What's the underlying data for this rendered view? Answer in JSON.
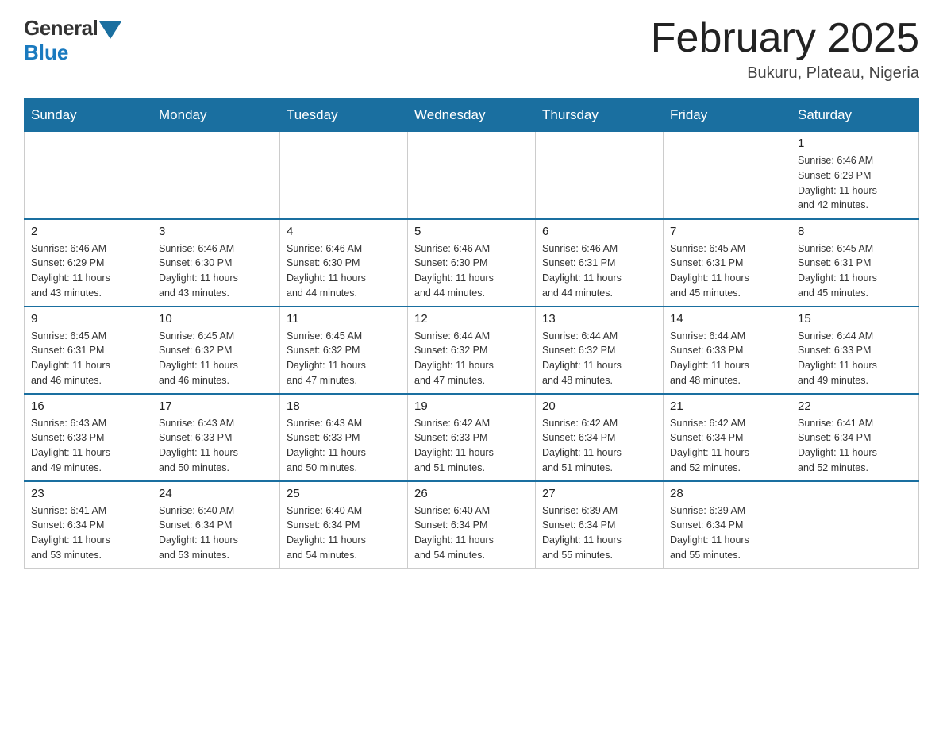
{
  "header": {
    "title": "February 2025",
    "location": "Bukuru, Plateau, Nigeria",
    "logo_general": "General",
    "logo_blue": "Blue"
  },
  "days_of_week": [
    "Sunday",
    "Monday",
    "Tuesday",
    "Wednesday",
    "Thursday",
    "Friday",
    "Saturday"
  ],
  "weeks": [
    [
      {
        "day": "",
        "info": ""
      },
      {
        "day": "",
        "info": ""
      },
      {
        "day": "",
        "info": ""
      },
      {
        "day": "",
        "info": ""
      },
      {
        "day": "",
        "info": ""
      },
      {
        "day": "",
        "info": ""
      },
      {
        "day": "1",
        "info": "Sunrise: 6:46 AM\nSunset: 6:29 PM\nDaylight: 11 hours\nand 42 minutes."
      }
    ],
    [
      {
        "day": "2",
        "info": "Sunrise: 6:46 AM\nSunset: 6:29 PM\nDaylight: 11 hours\nand 43 minutes."
      },
      {
        "day": "3",
        "info": "Sunrise: 6:46 AM\nSunset: 6:30 PM\nDaylight: 11 hours\nand 43 minutes."
      },
      {
        "day": "4",
        "info": "Sunrise: 6:46 AM\nSunset: 6:30 PM\nDaylight: 11 hours\nand 44 minutes."
      },
      {
        "day": "5",
        "info": "Sunrise: 6:46 AM\nSunset: 6:30 PM\nDaylight: 11 hours\nand 44 minutes."
      },
      {
        "day": "6",
        "info": "Sunrise: 6:46 AM\nSunset: 6:31 PM\nDaylight: 11 hours\nand 44 minutes."
      },
      {
        "day": "7",
        "info": "Sunrise: 6:45 AM\nSunset: 6:31 PM\nDaylight: 11 hours\nand 45 minutes."
      },
      {
        "day": "8",
        "info": "Sunrise: 6:45 AM\nSunset: 6:31 PM\nDaylight: 11 hours\nand 45 minutes."
      }
    ],
    [
      {
        "day": "9",
        "info": "Sunrise: 6:45 AM\nSunset: 6:31 PM\nDaylight: 11 hours\nand 46 minutes."
      },
      {
        "day": "10",
        "info": "Sunrise: 6:45 AM\nSunset: 6:32 PM\nDaylight: 11 hours\nand 46 minutes."
      },
      {
        "day": "11",
        "info": "Sunrise: 6:45 AM\nSunset: 6:32 PM\nDaylight: 11 hours\nand 47 minutes."
      },
      {
        "day": "12",
        "info": "Sunrise: 6:44 AM\nSunset: 6:32 PM\nDaylight: 11 hours\nand 47 minutes."
      },
      {
        "day": "13",
        "info": "Sunrise: 6:44 AM\nSunset: 6:32 PM\nDaylight: 11 hours\nand 48 minutes."
      },
      {
        "day": "14",
        "info": "Sunrise: 6:44 AM\nSunset: 6:33 PM\nDaylight: 11 hours\nand 48 minutes."
      },
      {
        "day": "15",
        "info": "Sunrise: 6:44 AM\nSunset: 6:33 PM\nDaylight: 11 hours\nand 49 minutes."
      }
    ],
    [
      {
        "day": "16",
        "info": "Sunrise: 6:43 AM\nSunset: 6:33 PM\nDaylight: 11 hours\nand 49 minutes."
      },
      {
        "day": "17",
        "info": "Sunrise: 6:43 AM\nSunset: 6:33 PM\nDaylight: 11 hours\nand 50 minutes."
      },
      {
        "day": "18",
        "info": "Sunrise: 6:43 AM\nSunset: 6:33 PM\nDaylight: 11 hours\nand 50 minutes."
      },
      {
        "day": "19",
        "info": "Sunrise: 6:42 AM\nSunset: 6:33 PM\nDaylight: 11 hours\nand 51 minutes."
      },
      {
        "day": "20",
        "info": "Sunrise: 6:42 AM\nSunset: 6:34 PM\nDaylight: 11 hours\nand 51 minutes."
      },
      {
        "day": "21",
        "info": "Sunrise: 6:42 AM\nSunset: 6:34 PM\nDaylight: 11 hours\nand 52 minutes."
      },
      {
        "day": "22",
        "info": "Sunrise: 6:41 AM\nSunset: 6:34 PM\nDaylight: 11 hours\nand 52 minutes."
      }
    ],
    [
      {
        "day": "23",
        "info": "Sunrise: 6:41 AM\nSunset: 6:34 PM\nDaylight: 11 hours\nand 53 minutes."
      },
      {
        "day": "24",
        "info": "Sunrise: 6:40 AM\nSunset: 6:34 PM\nDaylight: 11 hours\nand 53 minutes."
      },
      {
        "day": "25",
        "info": "Sunrise: 6:40 AM\nSunset: 6:34 PM\nDaylight: 11 hours\nand 54 minutes."
      },
      {
        "day": "26",
        "info": "Sunrise: 6:40 AM\nSunset: 6:34 PM\nDaylight: 11 hours\nand 54 minutes."
      },
      {
        "day": "27",
        "info": "Sunrise: 6:39 AM\nSunset: 6:34 PM\nDaylight: 11 hours\nand 55 minutes."
      },
      {
        "day": "28",
        "info": "Sunrise: 6:39 AM\nSunset: 6:34 PM\nDaylight: 11 hours\nand 55 minutes."
      },
      {
        "day": "",
        "info": ""
      }
    ]
  ]
}
